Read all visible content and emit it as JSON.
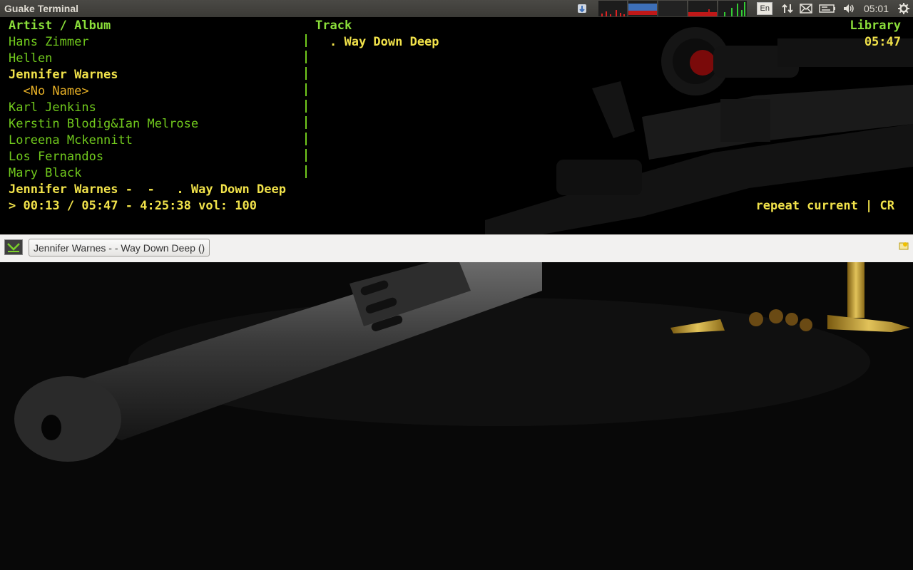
{
  "panel": {
    "app_title": "Guake Terminal",
    "keyboard_layout": "En",
    "clock": "05:01",
    "icons": [
      "updates-icon",
      "system-monitor-icon",
      "network-transfer-icon",
      "mail-icon",
      "battery-icon",
      "volume-icon",
      "gear-icon"
    ]
  },
  "terminal": {
    "header": {
      "artist_album": "Artist / Album",
      "track": "Track",
      "library": "Library"
    },
    "artists": [
      {
        "name": "Hans Zimmer",
        "state": "normal"
      },
      {
        "name": "Hellen",
        "state": "normal"
      },
      {
        "name": "Jennifer Warnes",
        "state": "selected"
      },
      {
        "name": "  <No Name>",
        "state": "album"
      },
      {
        "name": "Karl Jenkins",
        "state": "normal"
      },
      {
        "name": "Kerstin Blodig&Ian Melrose",
        "state": "normal"
      },
      {
        "name": "Loreena Mckennitt",
        "state": "normal"
      },
      {
        "name": "Los Fernandos",
        "state": "normal"
      },
      {
        "name": "Mary Black",
        "state": "normal"
      }
    ],
    "track_row": {
      "title": ". Way Down Deep",
      "duration": "05:47"
    },
    "now_playing": "Jennifer Warnes -  -   . Way Down Deep",
    "status": "> 00:13 / 05:47 - 4:25:38 vol: 100",
    "modes": "repeat current | CR"
  },
  "tabbar": {
    "tab_label": "Jennifer Warnes -  - Way Down Deep ()",
    "add_tab_icon": "terminal-add-icon"
  },
  "colors": {
    "term_green": "#71c91d",
    "term_yellow": "#f1e24a",
    "term_orange": "#e9b126",
    "panel_bg": "#3c3b37"
  }
}
